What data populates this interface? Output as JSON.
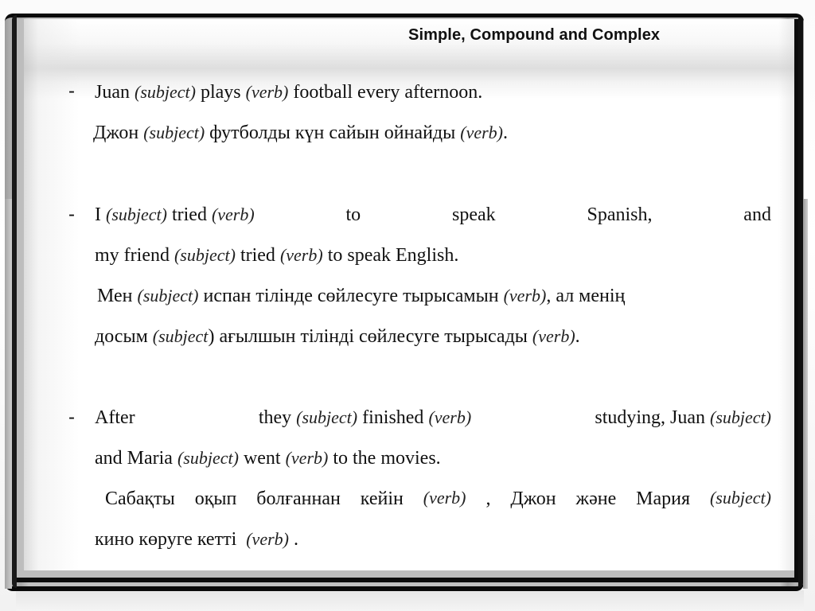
{
  "slide": {
    "title": "Simple, Compound and Complex",
    "bullet_symbol": "-",
    "items": [
      {
        "english": {
          "l1": {
            "a": "Juan ",
            "b": "(subject)",
            "c": " plays ",
            "d": "(verb)",
            "e": " football every afternoon."
          }
        },
        "kazakh": {
          "l1": {
            "a": "Джон ",
            "b": "(subject)",
            "c": " футболды күн сайын ойнайды ",
            "d": "(verb)",
            "e": "."
          }
        }
      },
      {
        "english": {
          "l1": {
            "w1": "I",
            "w2": "(subject)",
            "w3": "tried",
            "w4": "(verb)",
            "w5": "to",
            "w6": "speak",
            "w7": "Spanish,",
            "w8": "and"
          },
          "l2": {
            "a": "my friend ",
            "b": "(subject)",
            "c": " tried ",
            "d": "(verb)",
            "e": " to speak English."
          }
        },
        "kazakh": {
          "l1": {
            "a": "Мен ",
            "b": "(subject)",
            "c": " испан тілінде сөйлесуге тырысамын ",
            "d": "(verb)",
            "e": ", ал менің"
          },
          "l2": {
            "a": "досым ",
            "b": "(subject",
            "b2": ")",
            "c": "  ағылшын тілінді сөйлесуге тырысады ",
            "d": "(verb)",
            "e": "."
          }
        }
      },
      {
        "english": {
          "l1": {
            "w1": "After",
            "w2": "they",
            "w3": "(subject)",
            "w4": "finished",
            "w5": "(verb)",
            "w6": "studying, Juan",
            "w7": "(subject)"
          },
          "l2": {
            "a": "and Maria ",
            "b": "(subject)",
            "c": " went ",
            "d": "(verb)",
            "e": " to the movies."
          }
        },
        "kazakh": {
          "l1": {
            "w1": "Сабақты",
            "w2": "оқып",
            "w3": "болғаннан",
            "w4": "кейін",
            "w5": "(verb)",
            "w6": ",",
            "w7": "Джон",
            "w8": "және",
            "w9": "Мария",
            "w10": "(subject)"
          },
          "l2": {
            "a": "кино көруге кетті  ",
            "b": "(verb)",
            "c": " ."
          }
        }
      }
    ]
  }
}
